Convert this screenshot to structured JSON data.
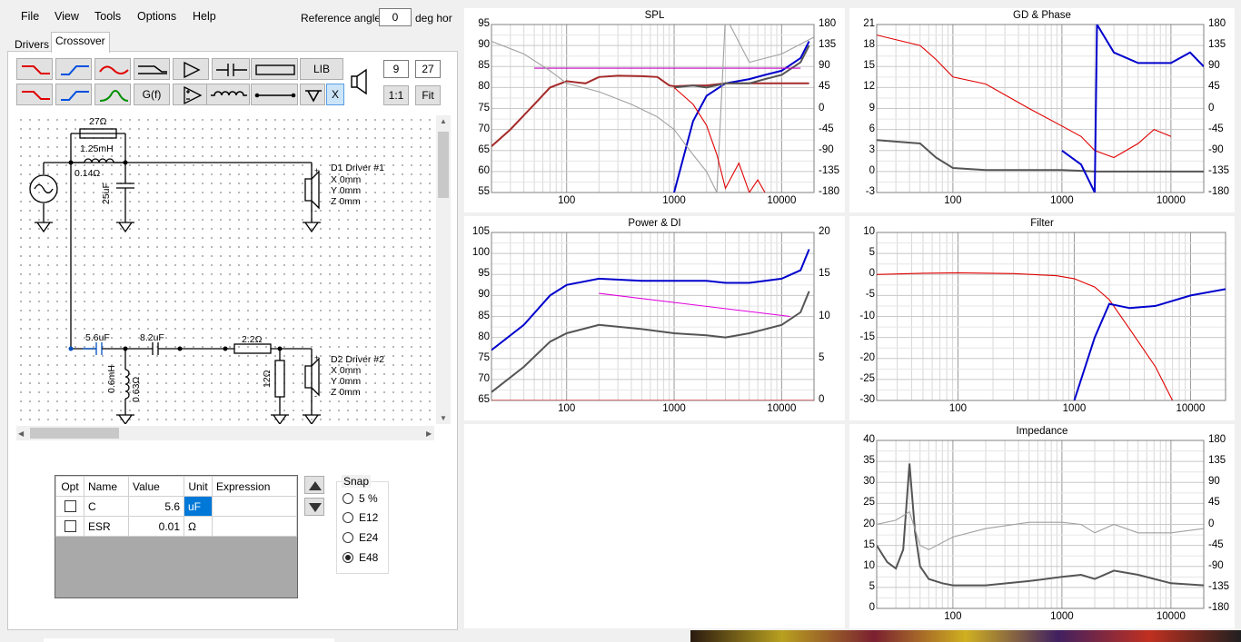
{
  "menu": [
    "File",
    "View",
    "Tools",
    "Options",
    "Help"
  ],
  "reference_angle": {
    "label": "Reference angle",
    "value": "0",
    "unit": "deg hor"
  },
  "tabs": [
    "Drivers",
    "Crossover"
  ],
  "toolbar": {
    "lib": "LIB",
    "gf": "G(f)",
    "x": "X",
    "num1": "9",
    "num2": "27",
    "one_to_one": "1:1",
    "fit": "Fit"
  },
  "schematic": {
    "r1": "27Ω",
    "l1": "1.25mH",
    "l1_esr": "0.14Ω",
    "c1": "25uF",
    "d1": {
      "name": "D1 Driver #1",
      "x": "X 0mm",
      "y": "Y 0mm",
      "z": "Z 0mm"
    },
    "c2": "5.6uF",
    "c3": "8.2uF",
    "r2": "2.2Ω",
    "l2": "0.6mH",
    "l2_esr": "0.63Ω",
    "r3": "12Ω",
    "d2": {
      "name": "D2 Driver #2",
      "x": "X 0mm",
      "y": "Y 0mm",
      "z": "Z 0mm"
    }
  },
  "props": {
    "headers": [
      "Opt",
      "Name",
      "Value",
      "Unit",
      "Expression"
    ],
    "rows": [
      {
        "name": "C",
        "value": "5.6",
        "unit": "uF",
        "expr": ""
      },
      {
        "name": "ESR",
        "value": "0.01",
        "unit": "Ω",
        "expr": ""
      }
    ]
  },
  "snap": {
    "title": "Snap",
    "options": [
      "5 %",
      "E12",
      "E24",
      "E48"
    ],
    "selected": "E48"
  },
  "chart_data": [
    {
      "type": "line",
      "title": "SPL",
      "x_scale": "log",
      "xlim": [
        20,
        20000
      ],
      "x_ticks": [
        "100",
        "1000",
        "10000"
      ],
      "yleft_ticks": [
        "95",
        "90",
        "85",
        "80",
        "75",
        "70",
        "65",
        "60",
        "55"
      ],
      "yright_ticks": [
        "180",
        "135",
        "90",
        "45",
        "0",
        "-45",
        "-90",
        "-135",
        "-180"
      ],
      "series": [
        {
          "color": "#a52a2a",
          "x": [
            20,
            30,
            50,
            70,
            100,
            150,
            200,
            300,
            500,
            700,
            900,
            1000,
            1500,
            2000,
            3000,
            5000,
            10000,
            15000,
            18000
          ],
          "y": [
            66,
            70,
            76,
            80,
            81.5,
            81,
            82.5,
            82.8,
            82.7,
            82.5,
            80.5,
            80.3,
            80.5,
            80.5,
            81,
            81,
            81,
            81,
            81
          ]
        },
        {
          "color": "#0000cd",
          "x": [
            1000,
            1500,
            2000,
            3000,
            5000,
            7000,
            10000,
            15000,
            18000
          ],
          "y": [
            55,
            72,
            78,
            81,
            82,
            83,
            84,
            87,
            91
          ]
        },
        {
          "color": "#555555",
          "x": [
            1000,
            1500,
            2000,
            3000,
            5000,
            7000,
            10000,
            15000,
            18000
          ],
          "y": [
            80,
            80.5,
            80,
            81,
            81,
            82,
            83,
            86,
            90
          ]
        },
        {
          "color": "#c000c0",
          "x": [
            50,
            15000
          ],
          "y": [
            84.6,
            84.6
          ]
        },
        {
          "color": "#a0a0a0",
          "x": [
            20,
            40,
            70,
            100,
            200,
            400,
            700,
            1000,
            1500,
            2000,
            2500,
            3000,
            5000,
            10000,
            20000
          ],
          "y": [
            91,
            88,
            84,
            81,
            79,
            76,
            73,
            70,
            64,
            60,
            55,
            97,
            86,
            88,
            92
          ]
        },
        {
          "color": "#e00000",
          "x": [
            1000,
            1500,
            2000,
            2500,
            3000,
            4000,
            5000,
            6000,
            7000
          ],
          "y": [
            80,
            76,
            71,
            64,
            56,
            62,
            55,
            58,
            55
          ]
        }
      ]
    },
    {
      "type": "line",
      "title": "GD & Phase",
      "x_scale": "log",
      "xlim": [
        20,
        20000
      ],
      "x_ticks": [
        "100",
        "1000",
        "10000"
      ],
      "yleft_ticks": [
        "21",
        "18",
        "15",
        "12",
        "9",
        "6",
        "3",
        "0",
        "-3"
      ],
      "yright_ticks": [
        "180",
        "135",
        "90",
        "45",
        "0",
        "-45",
        "-90",
        "-135",
        "-180"
      ],
      "series": [
        {
          "color": "#e00000",
          "x": [
            20,
            50,
            70,
            100,
            200,
            500,
            1000,
            1500,
            2000,
            3000,
            5000,
            7000,
            10000
          ],
          "y": [
            19.5,
            18,
            16,
            13.5,
            12.5,
            9,
            6.5,
            5,
            3,
            2,
            4,
            6,
            5
          ]
        },
        {
          "color": "#555555",
          "x": [
            20,
            50,
            70,
            100,
            200,
            500,
            1000,
            1500,
            2000,
            5000,
            10000,
            20000
          ],
          "y": [
            4.5,
            4,
            2,
            0.5,
            0.2,
            0.2,
            0.2,
            0.1,
            0,
            0,
            0,
            0
          ]
        },
        {
          "color": "#0000cd",
          "x": [
            1000,
            1500,
            2000,
            2100,
            3000,
            5000,
            10000,
            15000,
            20000
          ],
          "y": [
            3,
            1,
            -3,
            21,
            17,
            15.5,
            15.5,
            17,
            15
          ]
        }
      ]
    },
    {
      "type": "line",
      "title": "Power & DI",
      "x_scale": "log",
      "xlim": [
        20,
        20000
      ],
      "x_ticks": [
        "100",
        "1000",
        "10000"
      ],
      "yleft_ticks": [
        "105",
        "100",
        "95",
        "90",
        "85",
        "80",
        "75",
        "70",
        "65"
      ],
      "yright_ticks": [
        "20",
        "15",
        "10",
        "5",
        "0"
      ],
      "series": [
        {
          "color": "#0000cd",
          "x": [
            20,
            40,
            70,
            100,
            200,
            500,
            1000,
            2000,
            3000,
            5000,
            10000,
            15000,
            18000
          ],
          "y": [
            77,
            83,
            90,
            92.5,
            94,
            93.5,
            93.5,
            93.5,
            93,
            93,
            94,
            96,
            101
          ]
        },
        {
          "color": "#555555",
          "x": [
            20,
            40,
            70,
            100,
            200,
            500,
            1000,
            2000,
            3000,
            5000,
            10000,
            15000,
            18000
          ],
          "y": [
            67,
            73,
            79,
            81,
            83,
            82,
            81,
            80.5,
            80,
            81,
            83,
            86,
            91
          ]
        },
        {
          "color": "#e000e0",
          "x": [
            200,
            12000
          ],
          "y": [
            90.5,
            85
          ]
        },
        {
          "color": "#c00000",
          "x": [
            20,
            20000
          ],
          "y": [
            65,
            65
          ]
        }
      ]
    },
    {
      "type": "line",
      "title": "Filter",
      "x_scale": "log",
      "xlim": [
        20,
        20000
      ],
      "x_ticks": [
        "100",
        "1000",
        "10000"
      ],
      "yleft_ticks": [
        "10",
        "5",
        "0",
        "-5",
        "-10",
        "-15",
        "-20",
        "-25",
        "-30"
      ],
      "series": [
        {
          "color": "#e00000",
          "x": [
            20,
            50,
            100,
            300,
            700,
            1000,
            1500,
            2000,
            3000,
            5000,
            7000
          ],
          "y": [
            0,
            0.3,
            0.4,
            0.2,
            -0.3,
            -1,
            -3,
            -6,
            -13,
            -22,
            -30
          ]
        },
        {
          "color": "#0000cd",
          "x": [
            1000,
            1500,
            2000,
            3000,
            5000,
            10000,
            20000
          ],
          "y": [
            -30,
            -15,
            -7,
            -8,
            -7.5,
            -5,
            -3.5
          ]
        }
      ]
    },
    {
      "type": "line",
      "title": "Impedance",
      "x_scale": "log",
      "xlim": [
        20,
        20000
      ],
      "x_ticks": [
        "100",
        "1000",
        "10000"
      ],
      "yleft_ticks": [
        "40",
        "35",
        "30",
        "25",
        "20",
        "15",
        "10",
        "5",
        "0"
      ],
      "yright_ticks": [
        "180",
        "135",
        "90",
        "45",
        "0",
        "-45",
        "-90",
        "-135",
        "-180"
      ],
      "series": [
        {
          "color": "#555555",
          "x": [
            20,
            25,
            30,
            35,
            40,
            45,
            50,
            60,
            80,
            100,
            200,
            500,
            1000,
            1500,
            2000,
            3000,
            5000,
            10000,
            20000
          ],
          "y": [
            15,
            11,
            9.5,
            14,
            34.5,
            18,
            10,
            7,
            6,
            5.5,
            5.5,
            6.5,
            7.5,
            8,
            7,
            9,
            8,
            6,
            5.5
          ]
        },
        {
          "color": "#a0a0a0",
          "x": [
            20,
            30,
            40,
            50,
            60,
            100,
            200,
            500,
            1000,
            1500,
            2000,
            3000,
            5000,
            10000,
            20000
          ],
          "y": [
            20,
            21,
            23,
            15,
            14,
            17,
            19,
            20.5,
            20.5,
            20,
            18,
            20,
            18,
            18,
            19
          ]
        }
      ]
    }
  ]
}
